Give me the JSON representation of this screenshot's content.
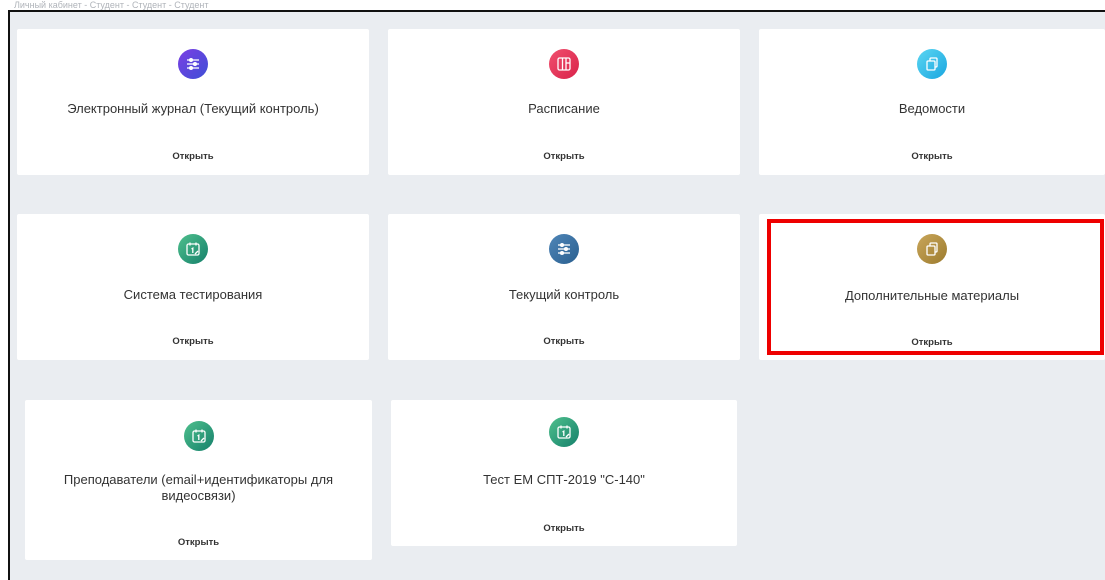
{
  "breadcrumb": "Личный кабинет - Студент - Студент - Студент",
  "cards": [
    {
      "title": "Электронный журнал (Текущий контроль)",
      "open": "Открыть",
      "icon": "sliders-icon",
      "color_from": "#7b3fe4",
      "color_to": "#3d4fd6"
    },
    {
      "title": "Расписание",
      "open": "Открыть",
      "icon": "layout-icon",
      "color_from": "#f0506e",
      "color_to": "#d9224a"
    },
    {
      "title": "Ведомости",
      "open": "Открыть",
      "icon": "copy-icon",
      "color_from": "#5bd6f2",
      "color_to": "#1aa6e0"
    },
    {
      "title": "Система тестирования",
      "open": "Открыть",
      "icon": "calendar-icon",
      "color_from": "#4fc08d",
      "color_to": "#15806b"
    },
    {
      "title": "Текущий контроль",
      "open": "Открыть",
      "icon": "sliders-icon",
      "color_from": "#4f86b8",
      "color_to": "#2a5f8f"
    },
    {
      "title": "Дополнительные материалы",
      "open": "Открыть",
      "icon": "copy-icon",
      "color_from": "#c9a65a",
      "color_to": "#9c7b2e"
    },
    {
      "title": "Преподаватели (email+идентификаторы для видеосвязи)",
      "open": "Открыть",
      "icon": "calendar-icon",
      "color_from": "#4fc08d",
      "color_to": "#15806b"
    },
    {
      "title": "Тест ЕМ СПТ-2019 \"С-140\"",
      "open": "Открыть",
      "icon": "calendar-icon",
      "color_from": "#4fc08d",
      "color_to": "#15806b"
    }
  ],
  "highlight_color": "#ee0000"
}
